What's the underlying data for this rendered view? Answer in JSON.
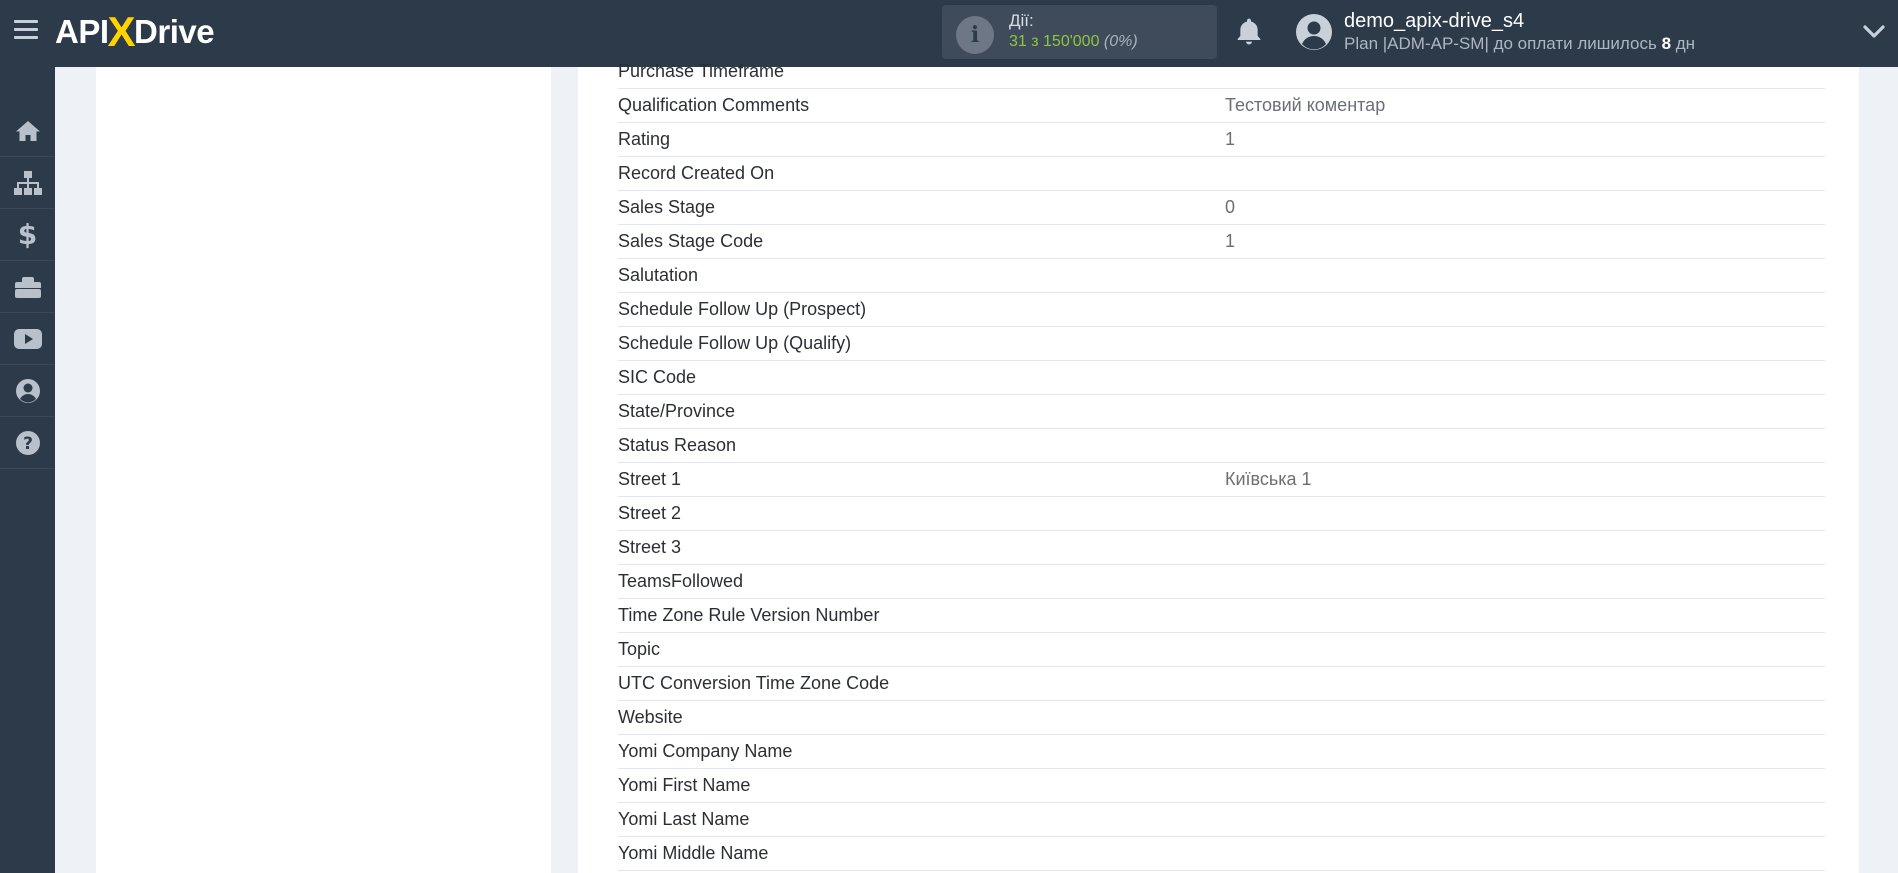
{
  "header": {
    "logo": {
      "left": "API",
      "x": "X",
      "right": "Drive"
    },
    "actions": {
      "label": "Дії:",
      "count": "31 з 150'000",
      "percent": "(0%)"
    },
    "user": {
      "name": "demo_apix-drive_s4",
      "plan_prefix": "Plan |ADM-AP-SM| до оплати лишилось",
      "plan_days": "8",
      "plan_suffix": "дн"
    }
  },
  "sidebar": {
    "items": [
      {
        "icon": "home-icon"
      },
      {
        "icon": "sitemap-icon"
      },
      {
        "icon": "dollar-icon"
      },
      {
        "icon": "briefcase-icon"
      },
      {
        "icon": "youtube-icon"
      },
      {
        "icon": "user-circle-icon"
      },
      {
        "icon": "help-icon"
      }
    ]
  },
  "fields": [
    {
      "label": "Purchase Timeframe",
      "value": ""
    },
    {
      "label": "Qualification Comments",
      "value": "Тестовий коментар"
    },
    {
      "label": "Rating",
      "value": "1"
    },
    {
      "label": "Record Created On",
      "value": ""
    },
    {
      "label": "Sales Stage",
      "value": "0"
    },
    {
      "label": "Sales Stage Code",
      "value": "1"
    },
    {
      "label": "Salutation",
      "value": ""
    },
    {
      "label": "Schedule Follow Up (Prospect)",
      "value": ""
    },
    {
      "label": "Schedule Follow Up (Qualify)",
      "value": ""
    },
    {
      "label": "SIC Code",
      "value": ""
    },
    {
      "label": "State/Province",
      "value": ""
    },
    {
      "label": "Status Reason",
      "value": ""
    },
    {
      "label": "Street 1",
      "value": "Київська 1"
    },
    {
      "label": "Street 2",
      "value": ""
    },
    {
      "label": "Street 3",
      "value": ""
    },
    {
      "label": "TeamsFollowed",
      "value": ""
    },
    {
      "label": "Time Zone Rule Version Number",
      "value": ""
    },
    {
      "label": "Topic",
      "value": ""
    },
    {
      "label": "UTC Conversion Time Zone Code",
      "value": ""
    },
    {
      "label": "Website",
      "value": ""
    },
    {
      "label": "Yomi Company Name",
      "value": ""
    },
    {
      "label": "Yomi First Name",
      "value": ""
    },
    {
      "label": "Yomi Last Name",
      "value": ""
    },
    {
      "label": "Yomi Middle Name",
      "value": ""
    }
  ]
}
